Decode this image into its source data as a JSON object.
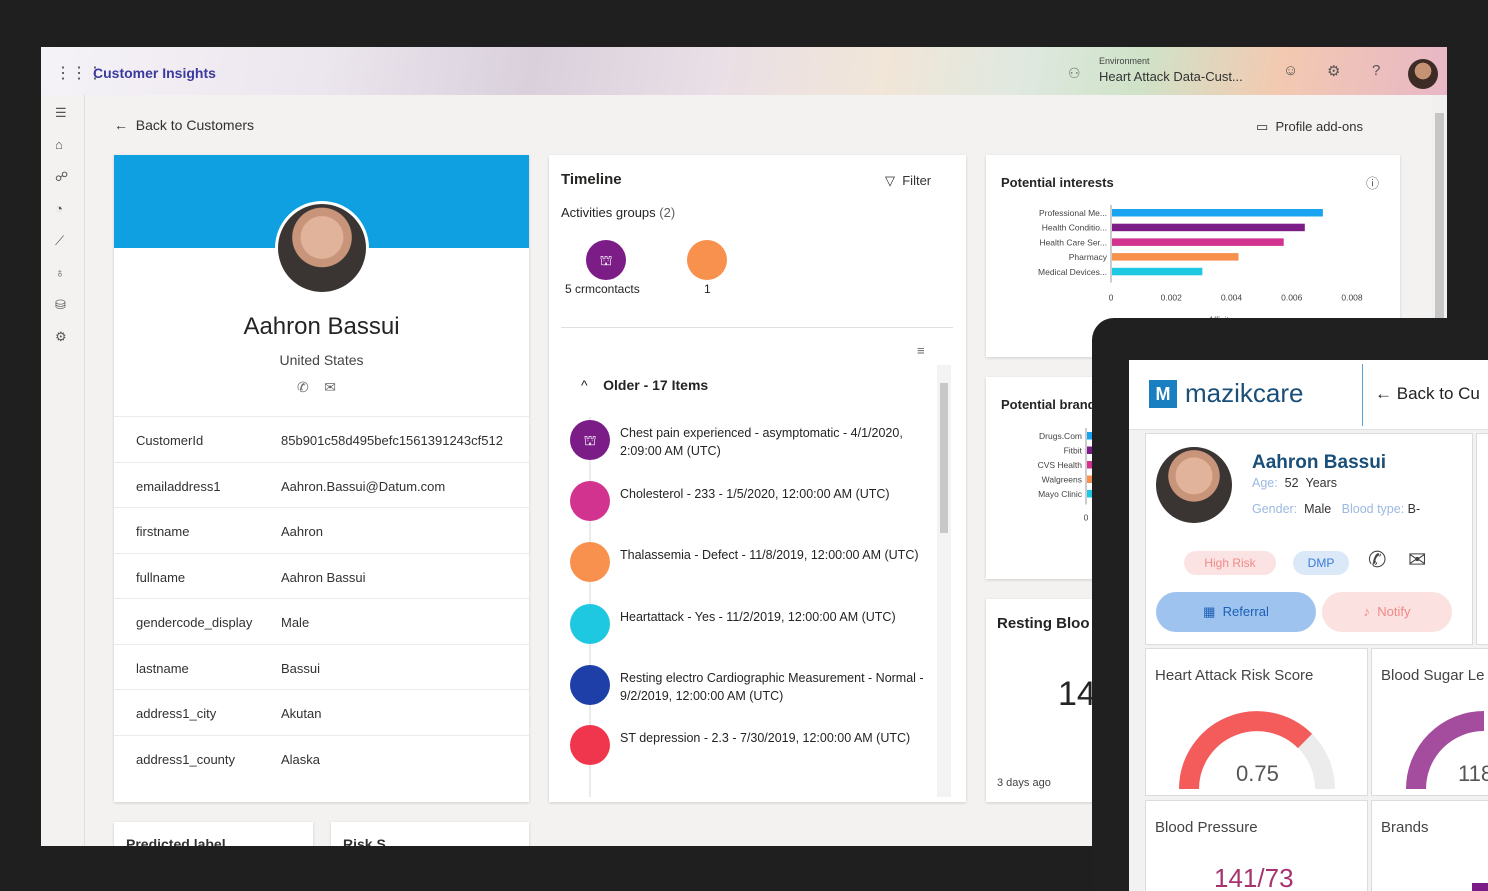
{
  "topbar": {
    "app_name": "Customer Insights",
    "env_label": "Environment",
    "env_value": "Heart Attack Data-Cust..."
  },
  "nav": {
    "back": "Back to Customers",
    "addons": "Profile add-ons"
  },
  "profile": {
    "name": "Aahron Bassui",
    "country": "United States",
    "attributes": [
      {
        "key": "CustomerId",
        "value": "85b901c58d495befc1561391243cf512"
      },
      {
        "key": "emailaddress1",
        "value": "Aahron.Bassui@Datum.com"
      },
      {
        "key": "firstname",
        "value": "Aahron"
      },
      {
        "key": "fullname",
        "value": "Aahron Bassui"
      },
      {
        "key": "gendercode_display",
        "value": "Male"
      },
      {
        "key": "lastname",
        "value": "Bassui"
      },
      {
        "key": "address1_city",
        "value": "Akutan"
      },
      {
        "key": "address1_county",
        "value": "Alaska"
      }
    ]
  },
  "timeline": {
    "title": "Timeline",
    "filter": "Filter",
    "groups_label": "Activities groups",
    "groups_count": "(2)",
    "groups": [
      {
        "label": "5 crmcontacts",
        "color": "#7b1c87"
      },
      {
        "label": "1",
        "color": "#f7914d"
      }
    ],
    "older": "Older - 17 Items",
    "events": [
      {
        "text": "Chest pain experienced - asymptomatic - 4/1/2020, 2:09:00 AM (UTC)",
        "color": "#7b1c87"
      },
      {
        "text": "Cholesterol - 233 - 1/5/2020, 12:00:00 AM (UTC)",
        "color": "#d2338f"
      },
      {
        "text": "Thalassemia - Defect - 11/8/2019, 12:00:00 AM (UTC)",
        "color": "#f7914d"
      },
      {
        "text": "Heartattack - Yes - 11/2/2019, 12:00:00 AM (UTC)",
        "color": "#1ec8e0"
      },
      {
        "text": "Resting electro Cardiographic Measurement - Normal - 9/2/2019, 12:00:00 AM (UTC)",
        "color": "#1f3fa8"
      },
      {
        "text": "ST depression - 2.3 - 7/30/2019, 12:00:00 AM (UTC)",
        "color": "#f0364c"
      }
    ]
  },
  "interests": {
    "title": "Potential interests",
    "axis_title": "Affinity score",
    "chart_data": {
      "type": "bar",
      "categories": [
        "Professional Me...",
        "Health Conditio...",
        "Health Care Ser...",
        "Pharmacy",
        "Medical Devices..."
      ],
      "values": [
        0.007,
        0.0064,
        0.0057,
        0.0042,
        0.003
      ],
      "colors": [
        "#1aa3f0",
        "#7b1c87",
        "#d2338f",
        "#f7914d",
        "#1ec8e0"
      ],
      "xticks": [
        "0",
        "0.002",
        "0.004",
        "0.006",
        "0.008"
      ],
      "xlim": [
        0,
        0.008
      ]
    }
  },
  "brands": {
    "title": "Potential brands",
    "chart_data": {
      "type": "bar",
      "categories": [
        "Drugs.Com",
        "Fitbit",
        "CVS Health",
        "Walgreens",
        "Mayo Clinic"
      ],
      "colors": [
        "#1aa3f0",
        "#7b1c87",
        "#d2338f",
        "#f7914d",
        "#1ec8e0"
      ],
      "xticks": [
        "0"
      ]
    }
  },
  "resting": {
    "title": "Resting Bloo",
    "value": "14",
    "age": "3 days ago"
  },
  "bottom_cards": {
    "predicted": "Predicted label",
    "risk": "Risk S"
  },
  "mazik": {
    "brand": "mazikcare",
    "back": "Back to Cu",
    "name": "Aahron Bassui",
    "age_label": "Age:",
    "age_value": "52",
    "age_unit": "Years",
    "gender_label": "Gender:",
    "gender_value": "Male",
    "blood_label": "Blood type:",
    "blood_value": "B-",
    "badge_risk": "High Risk",
    "badge_dmp": "DMP",
    "referral": "Referral",
    "notify": "Notify",
    "tiles": {
      "risk_title": "Heart Attack Risk Score",
      "risk_value": "0.75",
      "sugar_title": "Blood Sugar Le",
      "sugar_value": "118",
      "bp_title": "Blood Pressure",
      "bp_value": "141/73",
      "brands_title": "Brands"
    }
  }
}
